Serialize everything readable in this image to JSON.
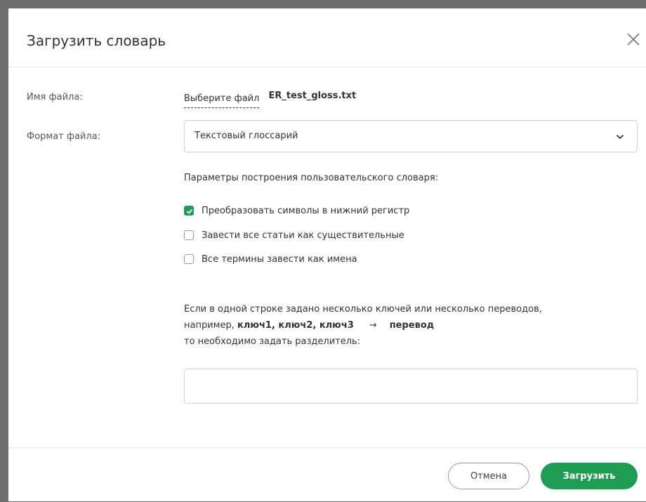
{
  "dialog": {
    "title": "Загрузить словарь",
    "close_icon": "close-icon"
  },
  "file": {
    "label": "Имя файла:",
    "choose_label": "Выберите файл",
    "file_name": "ER_test_gloss.txt"
  },
  "format": {
    "label": "Формат файла:",
    "selected": "Текстовый глоссарий",
    "chevron_icon": "chevron-down-icon"
  },
  "params": {
    "title": "Параметры построения пользовательского словаря:",
    "options": [
      {
        "label": "Преобразовать символы в нижний регистр",
        "checked": true
      },
      {
        "label": "Завести все статьи как существительные",
        "checked": false
      },
      {
        "label": "Все термины завести как имена",
        "checked": false
      }
    ]
  },
  "separator": {
    "line1": "Если в одной строке задано несколько ключей или несколько переводов,",
    "example_prefix": "например,",
    "example_keys": "ключ1, ключ2, ключ3",
    "arrow": "→",
    "example_translation": "перевод",
    "line3": "то необходимо задать разделитель:",
    "value": ""
  },
  "buttons": {
    "cancel": "Отмена",
    "load": "Загрузить"
  },
  "colors": {
    "accent": "#1f9d55",
    "backdrop": "#6e6e6e"
  }
}
